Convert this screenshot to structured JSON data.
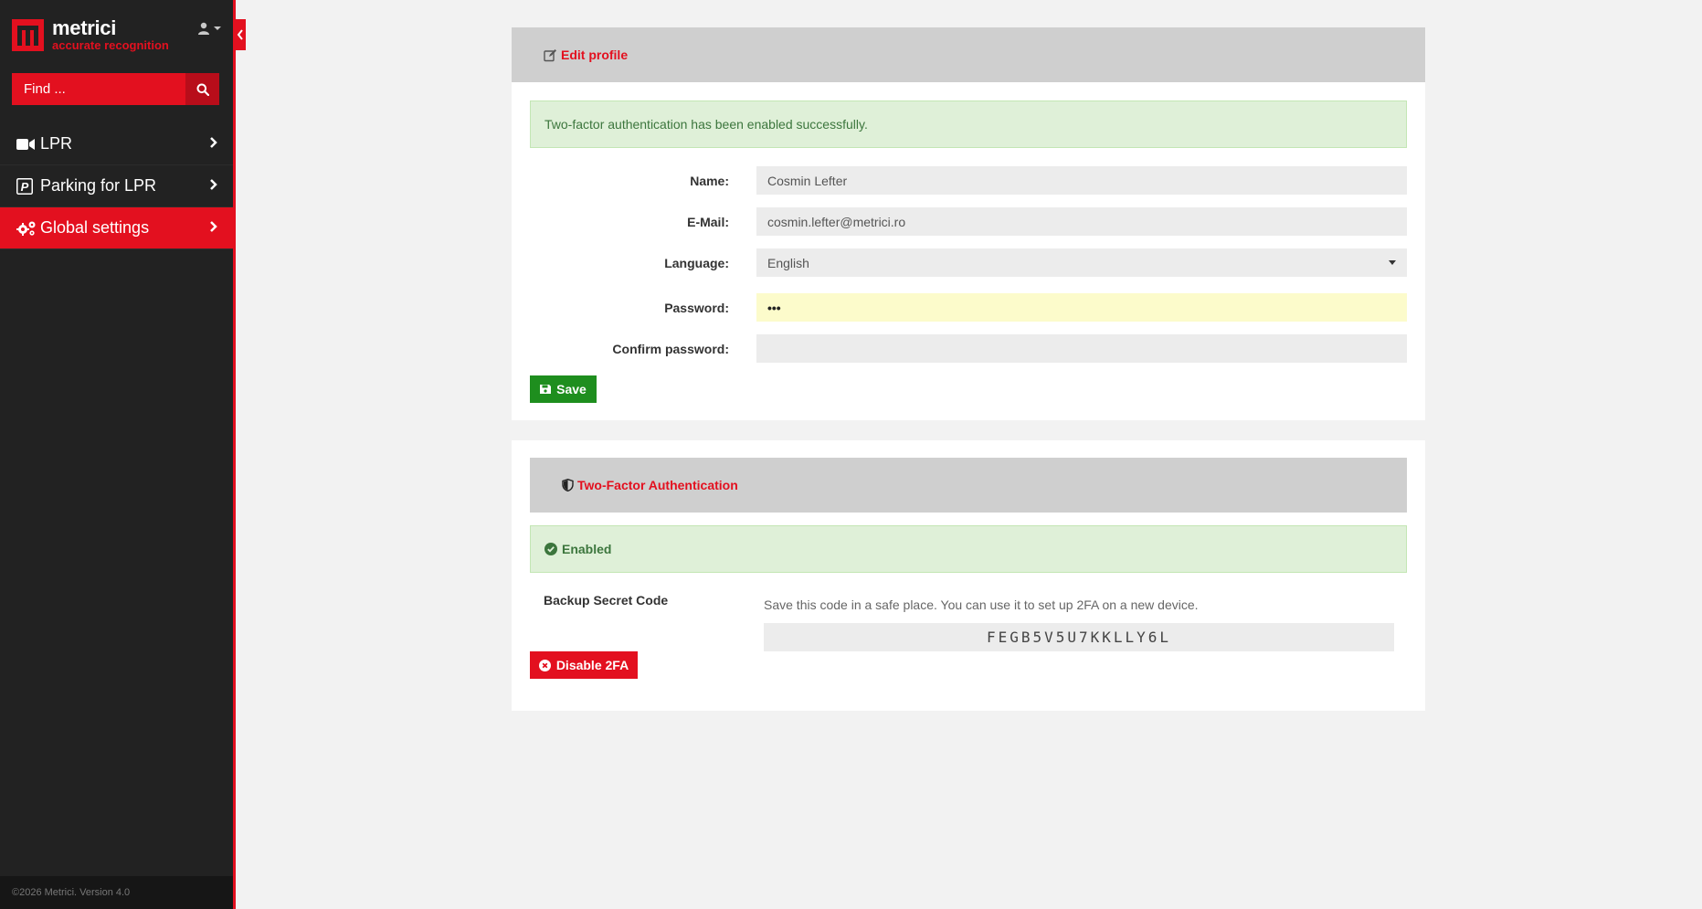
{
  "brand": {
    "name": "metrici",
    "tagline": "accurate recognition",
    "accent_color": "#e3101f"
  },
  "sidebar": {
    "search_placeholder": "Find ...",
    "items": [
      {
        "label": "LPR",
        "icon": "video-camera-icon",
        "active": false
      },
      {
        "label": "Parking for LPR",
        "icon": "parking-icon",
        "active": false
      },
      {
        "label": "Global settings",
        "icon": "gears-icon",
        "active": true
      }
    ],
    "footer": "©2026 Metrici. Version 4.0"
  },
  "profile": {
    "header": "Edit profile",
    "success_message": "Two-factor authentication has been enabled successfully.",
    "fields": {
      "name": {
        "label": "Name:",
        "value": "Cosmin Lefter"
      },
      "email": {
        "label": "E-Mail:",
        "value": "cosmin.lefter@metrici.ro"
      },
      "language": {
        "label": "Language:",
        "value": "English"
      },
      "password": {
        "label": "Password:",
        "value": "•••"
      },
      "confirm_password": {
        "label": "Confirm password:",
        "value": ""
      }
    },
    "save_label": "Save"
  },
  "two_factor": {
    "header": "Two-Factor Authentication",
    "status": "Enabled",
    "backup_label": "Backup Secret Code",
    "backup_help": "Save this code in a safe place. You can use it to set up 2FA on a new device.",
    "backup_code": "FEGB5V5U7KKLLY6L",
    "disable_label": "Disable 2FA"
  }
}
